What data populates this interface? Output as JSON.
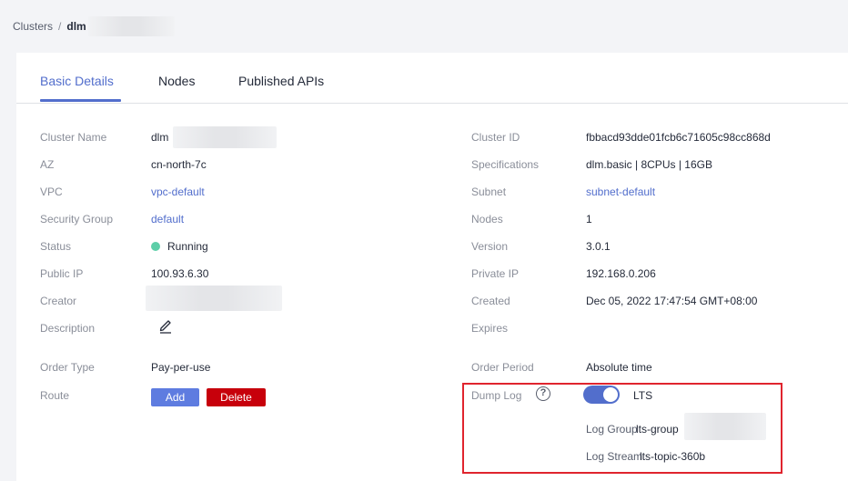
{
  "breadcrumb": {
    "root": "Clusters",
    "separator": "/",
    "current": "dlm"
  },
  "tabs": [
    {
      "label": "Basic Details",
      "active": true
    },
    {
      "label": "Nodes",
      "active": false
    },
    {
      "label": "Published APIs",
      "active": false
    }
  ],
  "left": {
    "cluster_name": {
      "label": "Cluster Name",
      "value": "dlm"
    },
    "az": {
      "label": "AZ",
      "value": "cn-north-7c"
    },
    "vpc": {
      "label": "VPC",
      "value": "vpc-default"
    },
    "security_group": {
      "label": "Security Group",
      "value": "default"
    },
    "status": {
      "label": "Status",
      "value": "Running"
    },
    "public_ip": {
      "label": "Public IP",
      "value": "100.93.6.30"
    },
    "creator": {
      "label": "Creator",
      "value": ""
    },
    "description": {
      "label": "Description",
      "icon": "edit-pencil-icon"
    },
    "order_type": {
      "label": "Order Type",
      "value": "Pay-per-use"
    },
    "route": {
      "label": "Route",
      "add_label": "Add",
      "delete_label": "Delete"
    }
  },
  "right": {
    "cluster_id": {
      "label": "Cluster ID",
      "value": "fbbacd93dde01fcb6c71605c98cc868d"
    },
    "specifications": {
      "label": "Specifications",
      "value": "dlm.basic | 8CPUs | 16GB"
    },
    "subnet": {
      "label": "Subnet",
      "value": "subnet-default"
    },
    "nodes": {
      "label": "Nodes",
      "value": "1"
    },
    "version": {
      "label": "Version",
      "value": "3.0.1"
    },
    "private_ip": {
      "label": "Private IP",
      "value": "192.168.0.206"
    },
    "created": {
      "label": "Created",
      "value": "Dec 05, 2022 17:47:54 GMT+08:00"
    },
    "expires": {
      "label": "Expires",
      "value": ""
    },
    "order_period": {
      "label": "Order Period",
      "value": "Absolute time"
    },
    "dump_log": {
      "label": "Dump Log",
      "help_glyph": "?",
      "enabled": true,
      "target": "LTS",
      "log_group_label": "Log Group",
      "log_group_value": "lts-group",
      "log_stream_label": "Log Stream",
      "log_stream_value": "lts-topic-360b"
    }
  },
  "colors": {
    "accent": "#526ecc",
    "add_button": "#5e7ce0",
    "delete_button": "#c7000b",
    "status_running": "#5dcea8",
    "highlight_border": "#e0242e"
  }
}
